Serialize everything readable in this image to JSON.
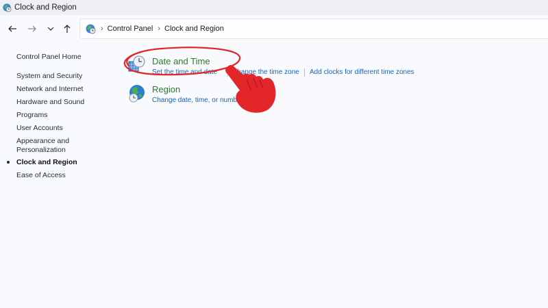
{
  "window": {
    "title": "Clock and Region"
  },
  "breadcrumb": {
    "items": [
      "Control Panel",
      "Clock and Region"
    ]
  },
  "sidebar": {
    "home": "Control Panel Home",
    "items": [
      "System and Security",
      "Network and Internet",
      "Hardware and Sound",
      "Programs",
      "User Accounts",
      "Appearance and",
      "Personalization",
      "Clock and Region",
      "Ease of Access"
    ],
    "active_item": "Clock and Region"
  },
  "categories": [
    {
      "title": "Date and Time",
      "icon": "date-time-icon",
      "links": [
        "Set the time and date",
        "Change the time zone",
        "Add clocks for different time zones"
      ]
    },
    {
      "title": "Region",
      "icon": "globe-clock-icon",
      "links": [
        "Change date, time, or number formats"
      ]
    }
  ],
  "annotation": {
    "highlight_color": "#e0272b",
    "hand_color": "#e3262a"
  },
  "colors": {
    "accent_link": "#1a63b8",
    "category_title": "#2a7a2a"
  }
}
